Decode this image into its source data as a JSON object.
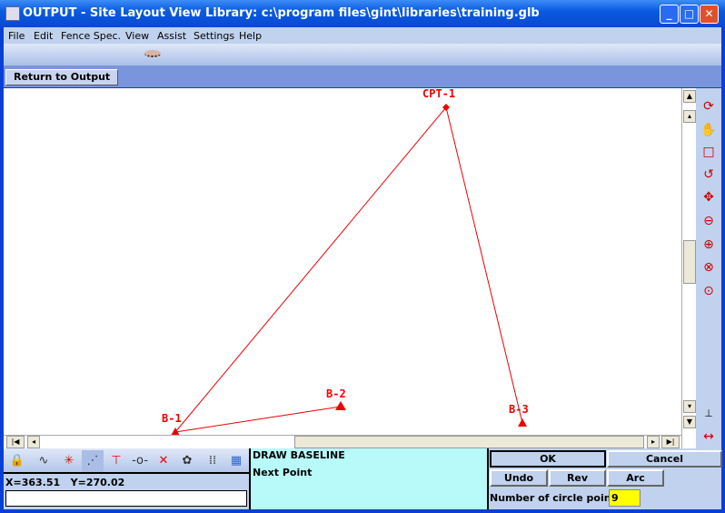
{
  "window": {
    "title": "OUTPUT - Site Layout View  Library: c:\\program files\\gint\\libraries\\training.glb"
  },
  "menu": [
    "File",
    "Edit",
    "Fence Spec.",
    "View",
    "Assist",
    "Settings",
    "Help"
  ],
  "return_button": "Return to Output",
  "drawing": {
    "points": [
      "CPT-1",
      "B-1",
      "B-2",
      "B-3"
    ],
    "line_color": "#e00000"
  },
  "status": {
    "coords": "X=363.51   Y=270.02",
    "command_input": ""
  },
  "prompt": {
    "title": "DRAW BASELINE",
    "sub": "Next Point"
  },
  "buttons": {
    "ok": "OK",
    "cancel": "Cancel",
    "undo": "Undo",
    "rev": "Rev",
    "arc": "Arc"
  },
  "circle": {
    "label": "Number of circle points",
    "value": "9"
  }
}
